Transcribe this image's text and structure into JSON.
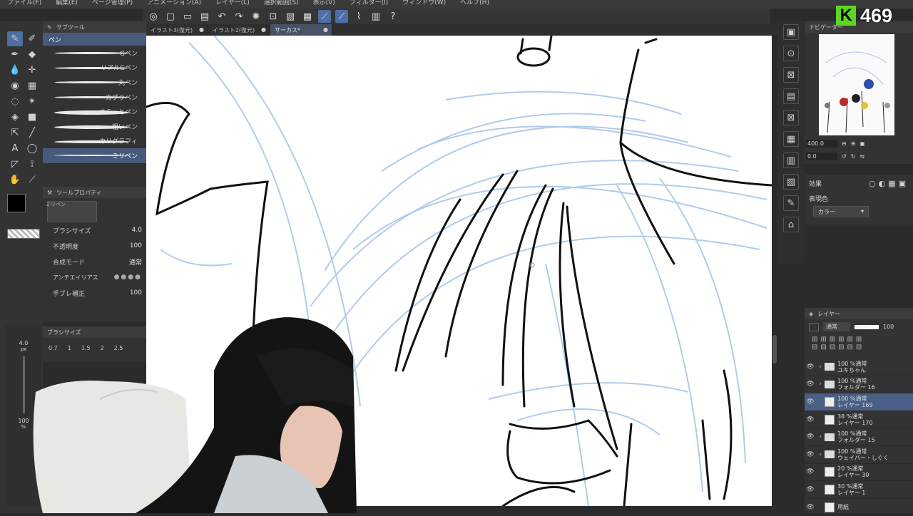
{
  "menu": [
    "ファイル(F)",
    "編集(E)",
    "ページ管理(P)",
    "アニメーション(A)",
    "レイヤー(L)",
    "選択範囲(S)",
    "表示(V)",
    "フィルター(I)",
    "ウィンドウ(W)",
    "ヘルプ(H)"
  ],
  "tabs": [
    {
      "label": "イラスト3(復元)",
      "close": "●"
    },
    {
      "label": "イラスト2(復元)",
      "close": "●"
    },
    {
      "label": "サーカス*",
      "close": "●"
    }
  ],
  "subtool": {
    "header": "サブツール",
    "group": "ペン",
    "brushes": [
      "Gペン",
      "リアルGペン",
      "丸ペン",
      "カブラペン",
      "さらっとペン",
      "粗いペン",
      "カリグラフィ",
      "ミリペン"
    ]
  },
  "toolprop": {
    "header": "ツールプロパティ",
    "current": "ミリペン",
    "rows": [
      {
        "label": "ブラシサイズ",
        "value": "4.0"
      },
      {
        "label": "不透明度",
        "value": "100"
      },
      {
        "label": "合成モード",
        "value": "通常"
      },
      {
        "label": "アンチエイリアス",
        "value": ""
      },
      {
        "label": "手ブレ補正",
        "value": "100"
      }
    ]
  },
  "brushsize": {
    "header": "ブラシサイズ",
    "sizes": [
      "0.7",
      "1",
      "1.5",
      "2",
      "2.5"
    ],
    "indicator": "4.0",
    "indicator_unit": "px",
    "opacity": "100",
    "opacity_unit": "%"
  },
  "navigator": {
    "header": "ナビゲーター",
    "zoom": "400.0",
    "angle": "0.0"
  },
  "effects": {
    "label": "効果",
    "colorexp_label": "表現色",
    "colorexp_value": "カラー"
  },
  "layerpanel": {
    "header": "レイヤー",
    "blend": "通常",
    "opacity": "100",
    "layers": [
      {
        "line1": "100 %通常",
        "line2": "ユキちゃん",
        "kind": "folder",
        "sel": false
      },
      {
        "line1": "100 %通常",
        "line2": "フォルダー 16",
        "kind": "folder",
        "sel": false
      },
      {
        "line1": "100 %通常",
        "line2": "レイヤー 169",
        "kind": "layer",
        "sel": true
      },
      {
        "line1": "38 %通常",
        "line2": "レイヤー 170",
        "kind": "layer",
        "sel": false
      },
      {
        "line1": "100 %通常",
        "line2": "フォルダー 15",
        "kind": "folder",
        "sel": false
      },
      {
        "line1": "100 %通常",
        "line2": "ウェイバー・しぐく",
        "kind": "folder",
        "sel": false
      },
      {
        "line1": "20 %通常",
        "line2": "レイヤー 30",
        "kind": "layer",
        "sel": false
      },
      {
        "line1": "30 %通常",
        "line2": "レイヤー 1",
        "kind": "layer",
        "sel": false
      },
      {
        "line1": "",
        "line2": "用紙",
        "kind": "paper",
        "sel": false
      }
    ]
  },
  "overlay": {
    "k": "K",
    "count": "469"
  },
  "colors": {
    "accent": "#4d6fa5",
    "selection": "#4a5f86",
    "badge": "#5cd620"
  }
}
